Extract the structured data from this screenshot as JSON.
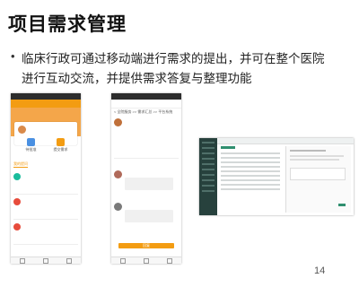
{
  "slide": {
    "title": "项目需求管理",
    "bullet_symbol": "•",
    "bullet_text": "临床行政可通过移动端进行需求的提出，并可在整个医院进行互动交流，并提供需求答复与整理功能",
    "page_number": "14"
  },
  "phone1": {
    "tab1_label": "待批准",
    "tab2_label": "提交需求",
    "list_label": "我的提问",
    "submit_label": "提交"
  },
  "phone2": {
    "breadcrumb": "< 全院服务 >> 需求汇总 >> 平台系统",
    "reply_label": "回复"
  }
}
